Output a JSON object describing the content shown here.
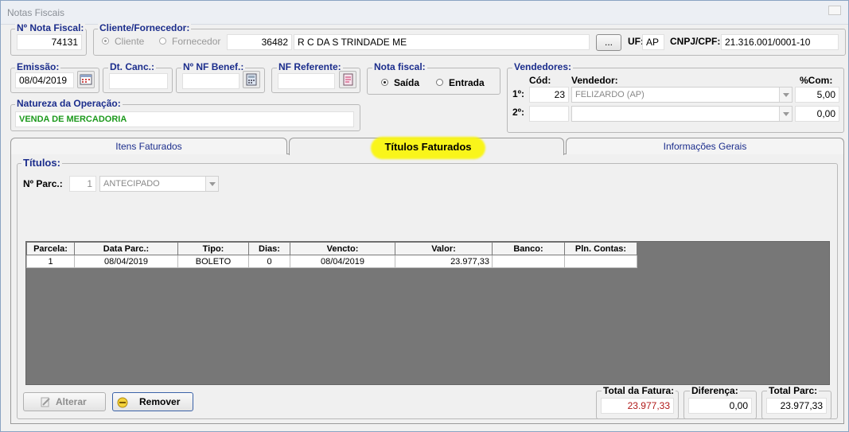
{
  "window": {
    "title": "Notas Fiscais"
  },
  "header": {
    "nota_fiscal": {
      "label": "Nº Nota Fiscal:",
      "value": "74131"
    },
    "cliente": {
      "label": "Cliente/Fornecedor:",
      "radio_cliente": "Cliente",
      "radio_fornecedor": "Fornecedor",
      "code": "36482",
      "name": "R C DA S TRINDADE ME",
      "browse_label": "...",
      "uf_label": "UF:",
      "uf_value": "AP",
      "cnpj_label": "CNPJ/CPF:",
      "cnpj_value": "21.316.001/0001-10"
    }
  },
  "emissao": {
    "label": "Emissão:",
    "value": "08/04/2019"
  },
  "dt_canc": {
    "label": "Dt. Canc.:",
    "value": ""
  },
  "nf_benef": {
    "label": "Nº NF Benef.:",
    "value": ""
  },
  "nf_referente": {
    "label": "NF Referente:",
    "value": ""
  },
  "nota_fiscal_tipo": {
    "label": "Nota fiscal:",
    "saida": "Saída",
    "entrada": "Entrada"
  },
  "natureza": {
    "label": "Natureza da Operação:",
    "value": "VENDA DE MERCADORIA"
  },
  "vendedores": {
    "label": "Vendedores:",
    "col_cod": "Cód:",
    "col_vendedor": "Vendedor:",
    "col_com": "%Com:",
    "rows": [
      {
        "label": "1º:",
        "cod": "23",
        "vendedor": "FELIZARDO (AP)",
        "com": "5,00"
      },
      {
        "label": "2º:",
        "cod": "",
        "vendedor": "",
        "com": "0,00"
      }
    ]
  },
  "tabs": [
    "Itens Faturados",
    "Títulos Faturados",
    "Informações Gerais"
  ],
  "titulos": {
    "label": "Títulos:",
    "parc_label": "Nº Parc.:",
    "parc_value": "1",
    "parc_type": "ANTECIPADO",
    "columns": [
      "Parcela:",
      "Data Parc.:",
      "Tipo:",
      "Dias:",
      "Vencto:",
      "Valor:",
      "Banco:",
      "Pln. Contas:"
    ],
    "rows": [
      [
        "1",
        "08/04/2019",
        "BOLETO",
        "0",
        "08/04/2019",
        "23.977,33",
        "",
        ""
      ]
    ]
  },
  "buttons": {
    "alterar": "Alterar",
    "remover": "Remover"
  },
  "totals": {
    "fatura_label": "Total da Fatura:",
    "fatura_value": "23.977,33",
    "diferenca_label": "Diferença:",
    "diferenca_value": "0,00",
    "parc_label": "Total Parc:",
    "parc_value": "23.977,33"
  },
  "colors": {
    "label_blue": "#1b2d8c",
    "natureza_green": "#1d9a1d",
    "total_red": "#b01818",
    "highlight": "#f9f51a",
    "grid_bg": "#777777"
  }
}
